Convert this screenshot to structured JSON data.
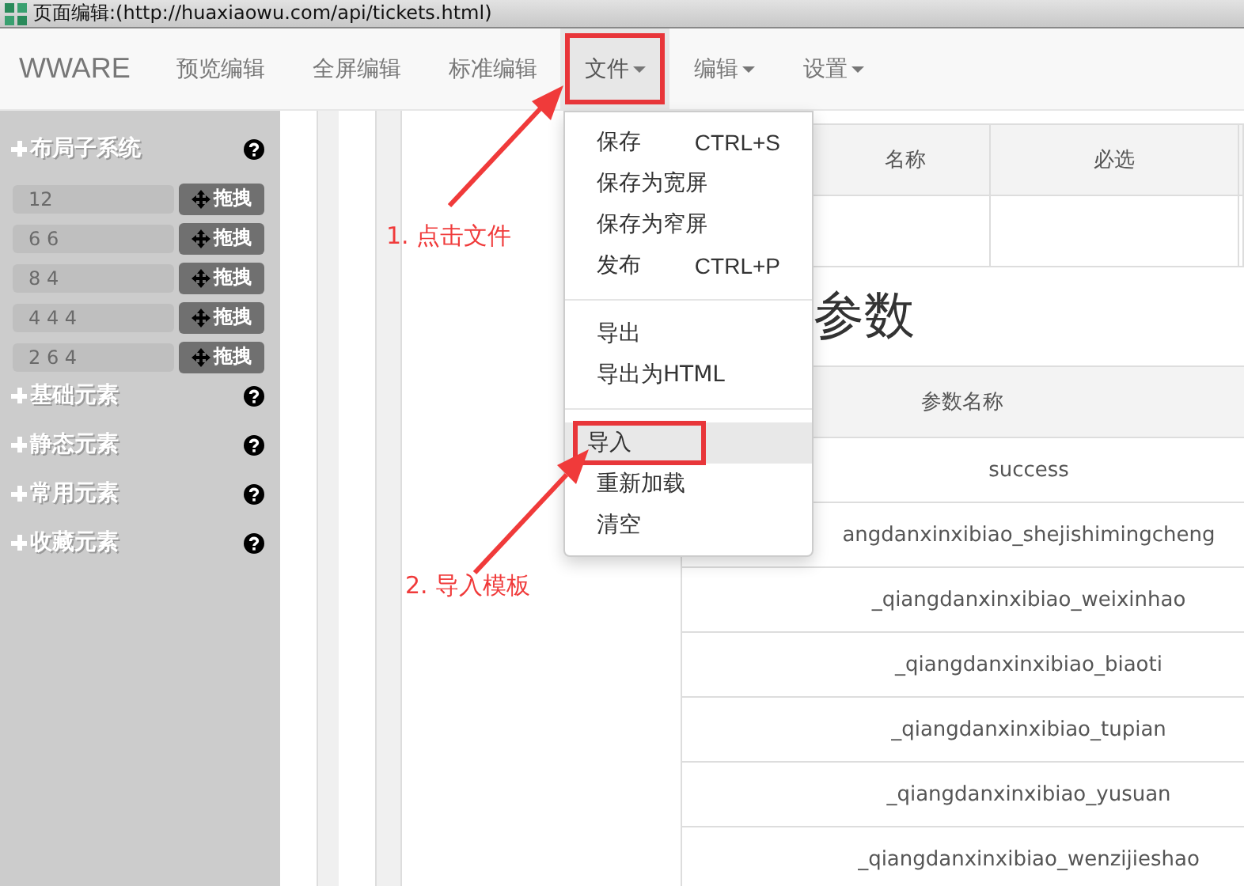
{
  "window": {
    "title": "页面编辑:(http://huaxiaowu.com/api/tickets.html)"
  },
  "navbar": {
    "brand": "WWARE",
    "items": [
      {
        "label": "预览编辑",
        "dropdown": false,
        "selected": false,
        "highlighted": false
      },
      {
        "label": "全屏编辑",
        "dropdown": false,
        "selected": false,
        "highlighted": false
      },
      {
        "label": "标准编辑",
        "dropdown": false,
        "selected": false,
        "highlighted": false
      },
      {
        "label": "文件",
        "dropdown": true,
        "selected": true,
        "highlighted": true
      },
      {
        "label": "编辑",
        "dropdown": true,
        "selected": false,
        "highlighted": false
      },
      {
        "label": "设置",
        "dropdown": true,
        "selected": false,
        "highlighted": false
      }
    ]
  },
  "sidebar": {
    "sections": [
      {
        "title": "布局子系统",
        "rows": [
          {
            "value": "12",
            "button": "拖拽"
          },
          {
            "value": "6 6",
            "button": "拖拽"
          },
          {
            "value": "8 4",
            "button": "拖拽"
          },
          {
            "value": "4 4 4",
            "button": "拖拽"
          },
          {
            "value": "2 6 4",
            "button": "拖拽"
          }
        ]
      },
      {
        "title": "基础元素"
      },
      {
        "title": "静态元素"
      },
      {
        "title": "常用元素"
      },
      {
        "title": "收藏元素"
      }
    ]
  },
  "dropdown_menu": {
    "groups": [
      [
        {
          "label": "保存",
          "shortcut": "CTRL+S",
          "selected": false,
          "highlighted": false
        },
        {
          "label": "保存为宽屏",
          "selected": false,
          "highlighted": false
        },
        {
          "label": "保存为窄屏",
          "selected": false,
          "highlighted": false
        },
        {
          "label": "发布",
          "shortcut": "CTRL+P",
          "selected": false,
          "highlighted": false
        }
      ],
      [
        {
          "label": "导出",
          "selected": false,
          "highlighted": false
        },
        {
          "label": "导出为HTML",
          "selected": false,
          "highlighted": false
        }
      ],
      [
        {
          "label": "导入",
          "selected": true,
          "highlighted": true
        },
        {
          "label": "重新加载",
          "selected": false,
          "highlighted": false
        },
        {
          "label": "清空",
          "selected": false,
          "highlighted": false
        }
      ]
    ]
  },
  "annotations": [
    "1. 点击文件",
    "2. 导入模板"
  ],
  "content": {
    "top_table": {
      "columns": [
        "名称",
        "必选"
      ]
    },
    "heading": "参数",
    "params_table": {
      "column": "参数名称",
      "rows": [
        "success",
        "angdanxinxibiao_shejishimingcheng",
        "_qiangdanxinxibiao_weixinhao",
        "_qiangdanxinxibiao_biaoti",
        "_qiangdanxinxibiao_tupian",
        "_qiangdanxinxibiao_yusuan",
        "_qiangdanxinxibiao_wenzijieshao"
      ]
    }
  }
}
